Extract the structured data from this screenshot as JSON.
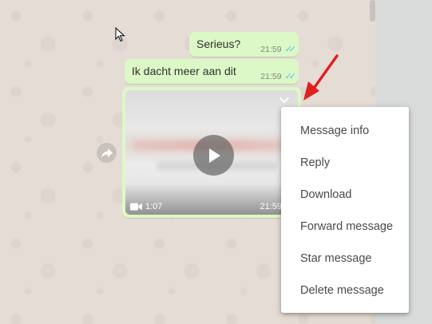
{
  "messages": [
    {
      "text": "Serieus?",
      "time": "21:59",
      "status": "read"
    },
    {
      "text": "Ik dacht meer aan dit",
      "time": "21:59",
      "status": "read"
    }
  ],
  "video_message": {
    "duration": "1:07",
    "time": "21:59",
    "icons": {
      "play": "play-icon",
      "menu": "chevron-down-icon",
      "camera": "video-camera-icon",
      "forward": "forward-icon"
    }
  },
  "context_menu": {
    "items": [
      "Message info",
      "Reply",
      "Download",
      "Forward message",
      "Star message",
      "Delete message"
    ]
  },
  "colors": {
    "outgoing_bubble": "#dcf8c6",
    "read_ticks": "#4fc3f7",
    "annotation_arrow": "#e02020",
    "wallpaper": "#e5ddd5"
  }
}
